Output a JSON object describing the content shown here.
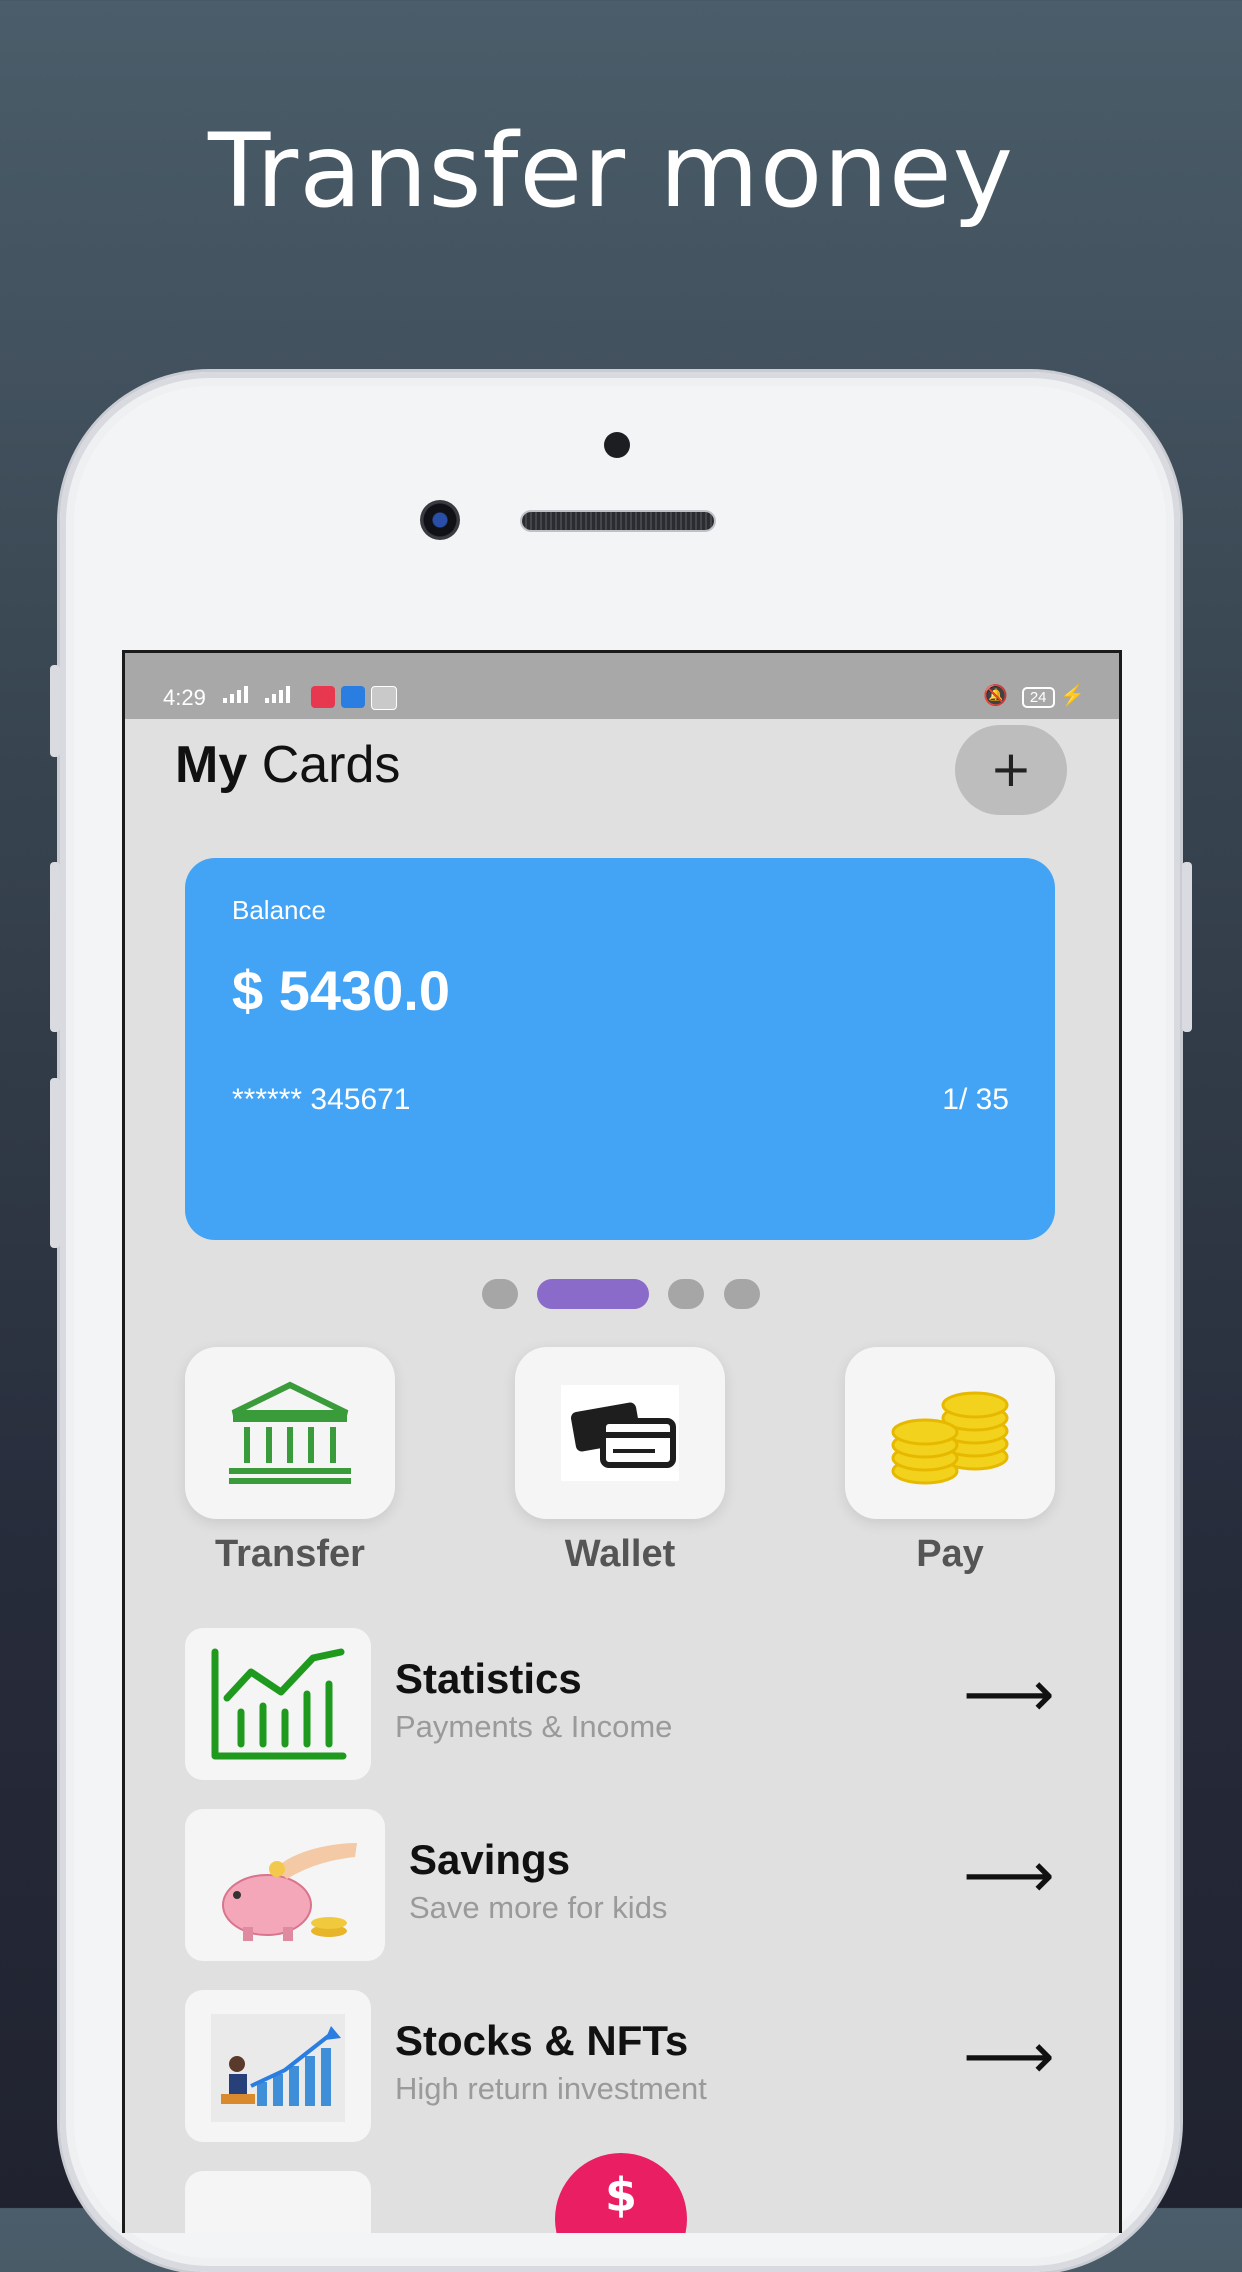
{
  "headline": "Transfer money",
  "status_bar": {
    "time": "4:29",
    "battery": "24",
    "icons": [
      "signal-icon",
      "signal-icon",
      "music-app-icon",
      "app-icon",
      "app-icon",
      "mute-icon",
      "battery-icon",
      "charging-icon"
    ]
  },
  "header": {
    "title_bold": "My",
    "title_rest": " Cards",
    "add_label": "+"
  },
  "card": {
    "label": "Balance",
    "balance": "$ 5430.0",
    "number": "****** 345671",
    "expiry": "1/ 35",
    "color": "#43a4f5"
  },
  "pager": {
    "pages": 4,
    "active_index": 1,
    "active_color": "#8a6bc9"
  },
  "actions": [
    {
      "label": "Transfer",
      "icon": "bank-icon"
    },
    {
      "label": "Wallet",
      "icon": "wallet-cards-icon"
    },
    {
      "label": "Pay",
      "icon": "coins-icon"
    }
  ],
  "rows": [
    {
      "title": "Statistics",
      "subtitle": "Payments & Income",
      "icon": "chart-icon",
      "arrow": "⟶"
    },
    {
      "title": "Savings",
      "subtitle": "Save more for kids",
      "icon": "piggy-bank-icon",
      "arrow": "⟶"
    },
    {
      "title": "Stocks & NFTs",
      "subtitle": "High return investment",
      "icon": "stocks-icon",
      "arrow": "⟶"
    }
  ],
  "fab": {
    "label": "$",
    "color": "#e91e63"
  }
}
